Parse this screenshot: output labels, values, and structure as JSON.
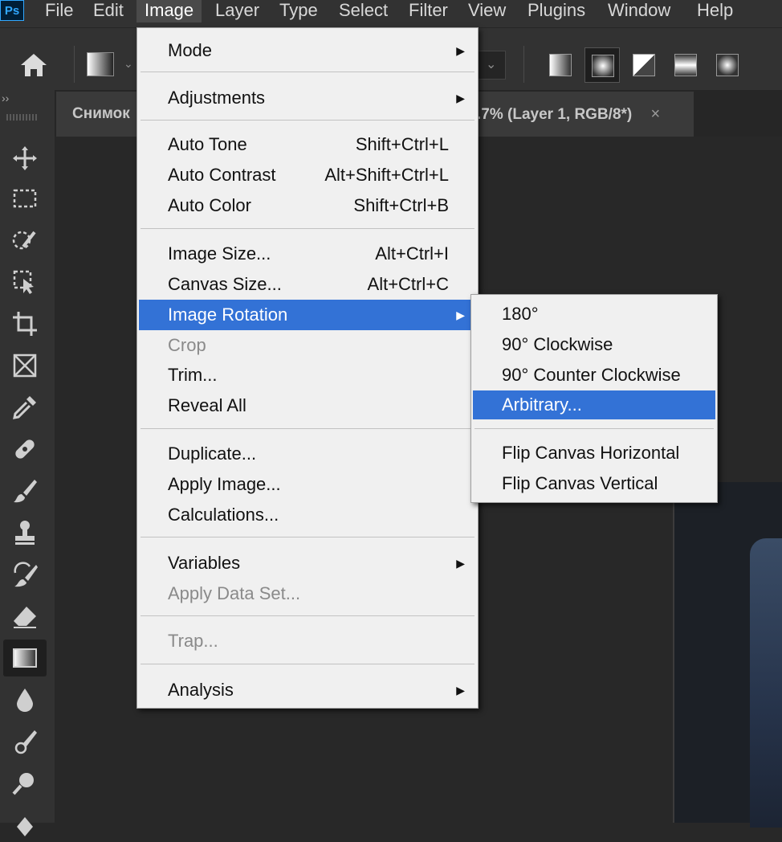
{
  "app": {
    "logo": "Ps"
  },
  "menubar": {
    "items": [
      "File",
      "Edit",
      "Image",
      "Layer",
      "Type",
      "Select",
      "Filter",
      "View",
      "Plugins",
      "Window",
      "Help"
    ]
  },
  "toolbar": {
    "collapse": "››"
  },
  "tabs": [
    {
      "label": "Снимок"
    },
    {
      "label": ".7% (Layer 1, RGB/8*)",
      "close": "×"
    }
  ],
  "image_menu": {
    "items": [
      {
        "label": "Mode",
        "submenu": true
      },
      {
        "label": "Adjustments",
        "submenu": true
      },
      {
        "label": "Auto Tone",
        "shortcut": "Shift+Ctrl+L"
      },
      {
        "label": "Auto Contrast",
        "shortcut": "Alt+Shift+Ctrl+L"
      },
      {
        "label": "Auto Color",
        "shortcut": "Shift+Ctrl+B"
      },
      {
        "label": "Image Size...",
        "shortcut": "Alt+Ctrl+I"
      },
      {
        "label": "Canvas Size...",
        "shortcut": "Alt+Ctrl+C"
      },
      {
        "label": "Image Rotation",
        "submenu": true,
        "highlighted": true
      },
      {
        "label": "Crop",
        "disabled": true
      },
      {
        "label": "Trim..."
      },
      {
        "label": "Reveal All"
      },
      {
        "label": "Duplicate..."
      },
      {
        "label": "Apply Image..."
      },
      {
        "label": "Calculations..."
      },
      {
        "label": "Variables",
        "submenu": true
      },
      {
        "label": "Apply Data Set...",
        "disabled": true
      },
      {
        "label": "Trap...",
        "disabled": true
      },
      {
        "label": "Analysis",
        "submenu": true
      }
    ]
  },
  "rotation_submenu": {
    "items": [
      {
        "label": "180°"
      },
      {
        "label": "90° Clockwise"
      },
      {
        "label": "90° Counter Clockwise"
      },
      {
        "label": "Arbitrary...",
        "highlighted": true
      },
      {
        "label": "Flip Canvas Horizontal"
      },
      {
        "label": "Flip Canvas Vertical"
      }
    ]
  },
  "colors": {
    "menu_highlight": "#3372d6",
    "menu_background": "#f0f0f0",
    "app_background": "#282828"
  }
}
